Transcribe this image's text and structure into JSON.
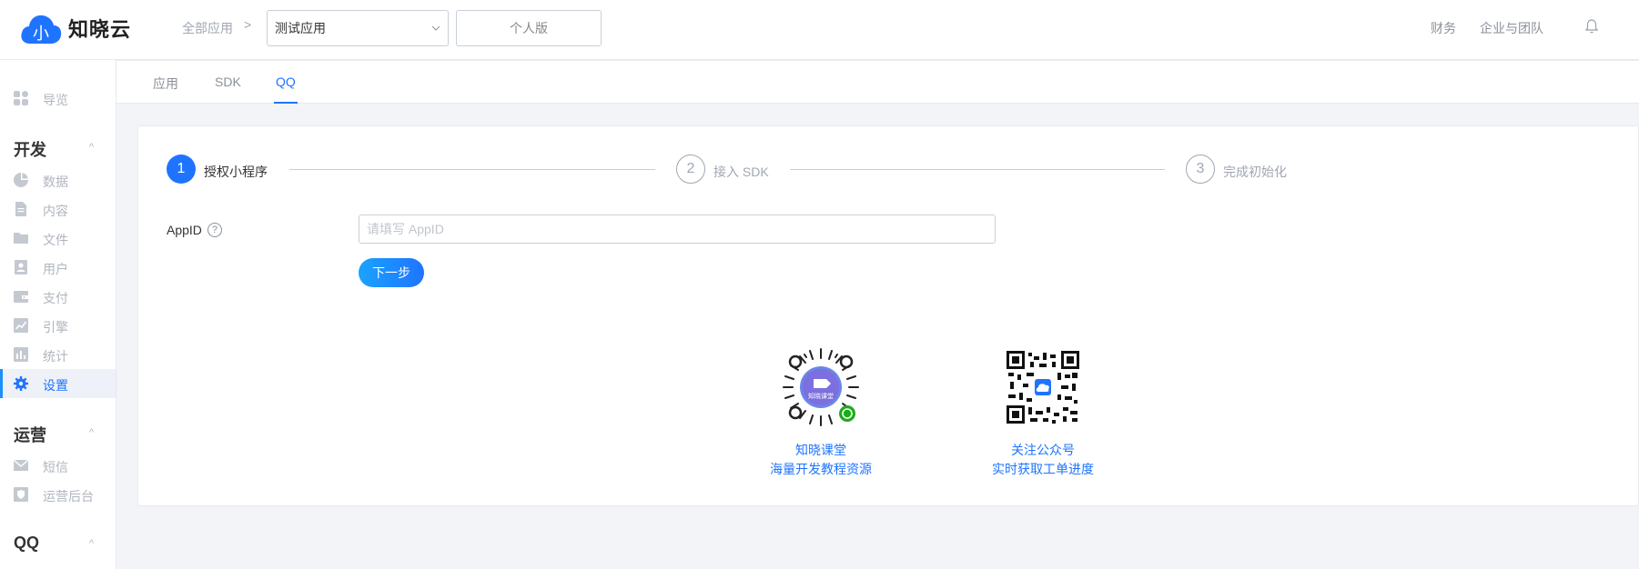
{
  "brand": {
    "name": "知晓云",
    "mark_text": "小",
    "color": "#1f74ff"
  },
  "header": {
    "breadcrumb_root": "全部应用",
    "breadcrumb_sep": ">",
    "app_select_value": "测试应用",
    "edition_label": "个人版",
    "finance_label": "财务",
    "enterprise_label": "企业与团队",
    "bell_icon": "bell-icon"
  },
  "sidebar": {
    "overview": "导览",
    "groups": [
      {
        "label": "开发",
        "caret": "^"
      },
      {
        "label": "运营",
        "caret": "^"
      },
      {
        "label": "QQ",
        "caret": "^"
      }
    ],
    "dev_items": [
      {
        "label": "数据",
        "icon": "pie-chart-icon"
      },
      {
        "label": "内容",
        "icon": "document-icon"
      },
      {
        "label": "文件",
        "icon": "folder-icon"
      },
      {
        "label": "用户",
        "icon": "user-card-icon"
      },
      {
        "label": "支付",
        "icon": "wallet-icon"
      },
      {
        "label": "引擎",
        "icon": "trend-chart-icon"
      },
      {
        "label": "统计",
        "icon": "bar-chart-icon"
      },
      {
        "label": "设置",
        "icon": "gear-icon",
        "active": true
      }
    ],
    "ops_items": [
      {
        "label": "短信",
        "icon": "mail-icon"
      },
      {
        "label": "运营后台",
        "icon": "shield-icon"
      }
    ]
  },
  "tabs": [
    {
      "label": "应用",
      "active": false
    },
    {
      "label": "SDK",
      "active": false
    },
    {
      "label": "QQ",
      "active": true
    }
  ],
  "steps": [
    {
      "num": "1",
      "label": "授权小程序",
      "state": "done"
    },
    {
      "num": "2",
      "label": "接入 SDK",
      "state": "todo"
    },
    {
      "num": "3",
      "label": "完成初始化",
      "state": "todo"
    }
  ],
  "form": {
    "appid_label": "AppID",
    "help_glyph": "?",
    "appid_value": "",
    "appid_placeholder": "请填写 AppID",
    "next_label": "下一步"
  },
  "qr_codes": [
    {
      "title": "知晓课堂",
      "subtitle": "海量开发教程资源",
      "badge_text": "知晓课堂"
    },
    {
      "title": "关注公众号",
      "subtitle": "实时获取工单进度"
    }
  ]
}
